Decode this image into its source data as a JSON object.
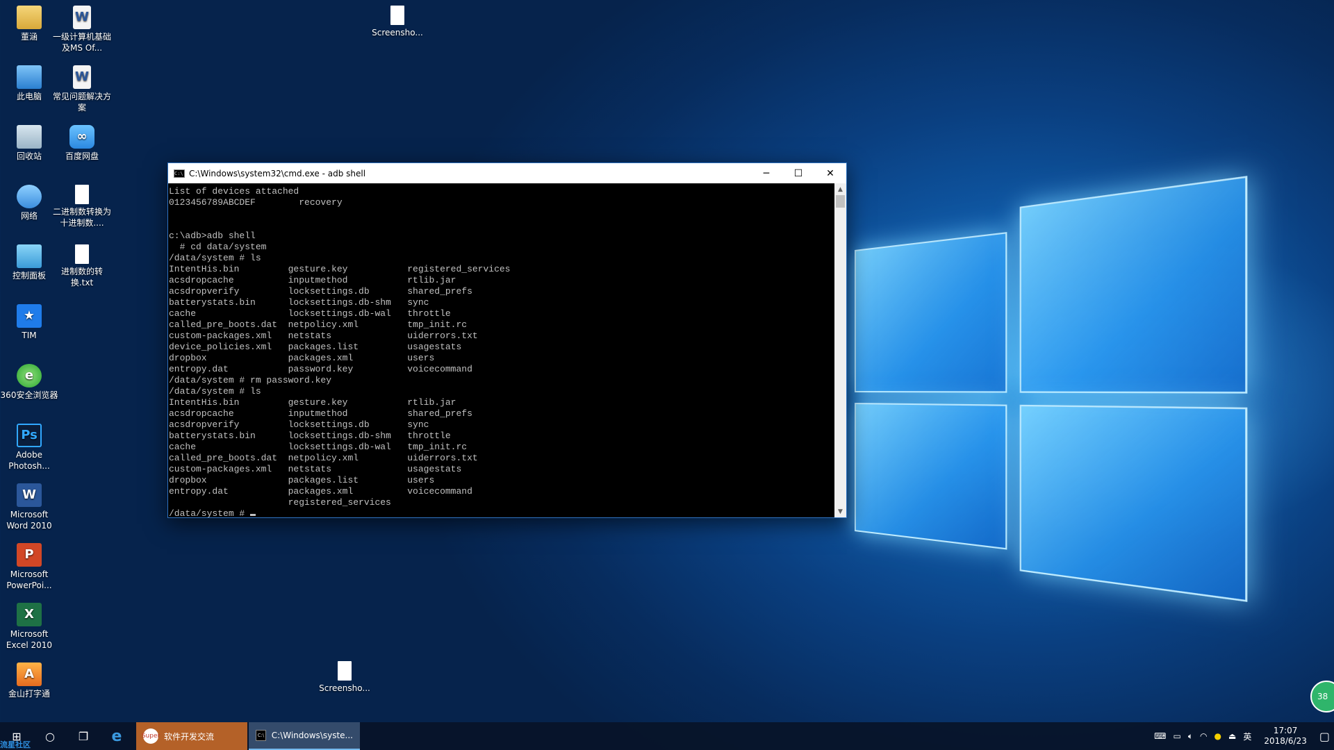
{
  "desktop": {
    "icons": [
      {
        "label": "董涵",
        "glyph": "",
        "kind": "folder"
      },
      {
        "label": "一级计算机基础及MS Of...",
        "glyph": "W",
        "kind": "doc"
      },
      {
        "label": "此电脑",
        "glyph": "",
        "kind": "pc"
      },
      {
        "label": "常见问题解决方案",
        "glyph": "W",
        "kind": "doc"
      },
      {
        "label": "回收站",
        "glyph": "",
        "kind": "bin"
      },
      {
        "label": "百度网盘",
        "glyph": "∞",
        "kind": "disk"
      },
      {
        "label": "网络",
        "glyph": "",
        "kind": "net"
      },
      {
        "label": "二进制数转换为十进制数....",
        "glyph": "",
        "kind": "paper"
      },
      {
        "label": "控制面板",
        "glyph": "",
        "kind": "ctrl"
      },
      {
        "label": "进制数的转换.txt",
        "glyph": "",
        "kind": "paper"
      },
      {
        "label": "TIM",
        "glyph": "★",
        "kind": "tim"
      },
      {
        "label": "360安全浏览器",
        "glyph": "e",
        "kind": "browser"
      },
      {
        "label": "Adobe Photosh...",
        "glyph": "Ps",
        "kind": "ps"
      },
      {
        "label": "Microsoft Word 2010",
        "glyph": "W",
        "kind": "word"
      },
      {
        "label": "Microsoft PowerPoi...",
        "glyph": "P",
        "kind": "ppt"
      },
      {
        "label": "Microsoft Excel 2010",
        "glyph": "X",
        "kind": "excel"
      },
      {
        "label": "金山打字通",
        "glyph": "A",
        "kind": "jinshan"
      },
      {
        "label": "Screensho...",
        "glyph": "",
        "kind": "paper"
      },
      {
        "label": "Screensho...",
        "glyph": "",
        "kind": "paper"
      }
    ]
  },
  "cmd": {
    "title": "C:\\Windows\\system32\\cmd.exe - adb  shell",
    "minimize": "─",
    "maximize": "☐",
    "close": "✕",
    "lines": [
      "List of devices attached",
      "0123456789ABCDEF        recovery",
      "",
      "",
      "c:\\adb>adb shell",
      "  # cd data/system",
      "/data/system # ls",
      "IntentHis.bin         gesture.key           registered_services",
      "acsdropcache          inputmethod           rtlib.jar",
      "acsdropverify         locksettings.db       shared_prefs",
      "batterystats.bin      locksettings.db-shm   sync",
      "cache                 locksettings.db-wal   throttle",
      "called_pre_boots.dat  netpolicy.xml         tmp_init.rc",
      "custom-packages.xml   netstats              uiderrors.txt",
      "device_policies.xml   packages.list         usagestats",
      "dropbox               packages.xml          users",
      "entropy.dat           password.key          voicecommand",
      "/data/system # rm password.key",
      "/data/system # ls",
      "IntentHis.bin         gesture.key           rtlib.jar",
      "acsdropcache          inputmethod           shared_prefs",
      "acsdropverify         locksettings.db       sync",
      "batterystats.bin      locksettings.db-shm   throttle",
      "cache                 locksettings.db-wal   tmp_init.rc",
      "called_pre_boots.dat  netpolicy.xml         uiderrors.txt",
      "custom-packages.xml   netstats              usagestats",
      "dropbox               packages.list         users",
      "entropy.dat           packages.xml          voicecommand",
      "                      registered_services"
    ],
    "prompt": "/data/system # "
  },
  "taskbar": {
    "start": "⊞",
    "search": "○",
    "taskview": "❐",
    "edge": "e",
    "apps": [
      {
        "label": "软件开发交流",
        "icon": "Super"
      },
      {
        "label": "C:\\Windows\\syste...",
        "icon": "C:\\"
      }
    ],
    "tray": {
      "ime": "英",
      "time": "17:07",
      "date": "2018/6/23"
    },
    "watermark": "流星社区"
  },
  "badge": "38"
}
